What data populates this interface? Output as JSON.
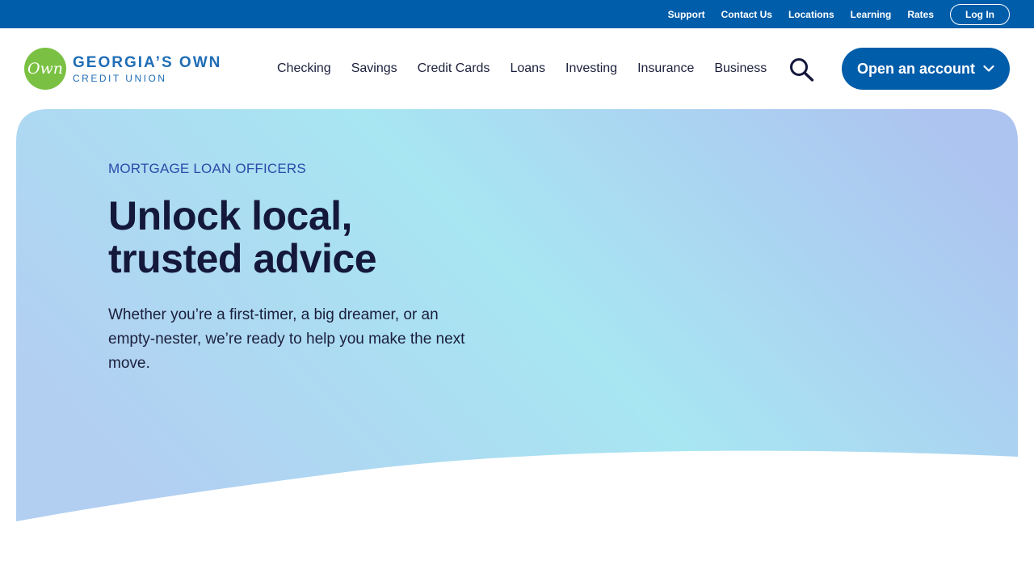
{
  "utility_nav": {
    "links": [
      "Support",
      "Contact Us",
      "Locations",
      "Learning",
      "Rates"
    ],
    "login_label": "Log In"
  },
  "logo": {
    "mark": "Own",
    "line1": "GEORGIA’S OWN",
    "line2": "CREDIT UNION"
  },
  "main_nav": {
    "items": [
      "Checking",
      "Savings",
      "Credit Cards",
      "Loans",
      "Investing",
      "Insurance",
      "Business"
    ]
  },
  "header": {
    "search_icon": "search-icon",
    "cta_label": "Open an account",
    "cta_icon": "chevron-down-icon"
  },
  "hero": {
    "eyebrow": "MORTGAGE LOAN OFFICERS",
    "title_line1": "Unlock local,",
    "title_line2": "trusted advice",
    "body": "Whether you’re a first-timer, a big dreamer, or an empty-nester, we’re ready to help you make the next move."
  },
  "colors": {
    "brand_blue": "#005daa",
    "brand_green": "#7ac143",
    "heading_navy": "#14183a",
    "eyebrow_blue": "#2b4aa8",
    "hero_gradient": [
      "#b0cff2",
      "#a8e6f2",
      "#aec4f0"
    ]
  }
}
